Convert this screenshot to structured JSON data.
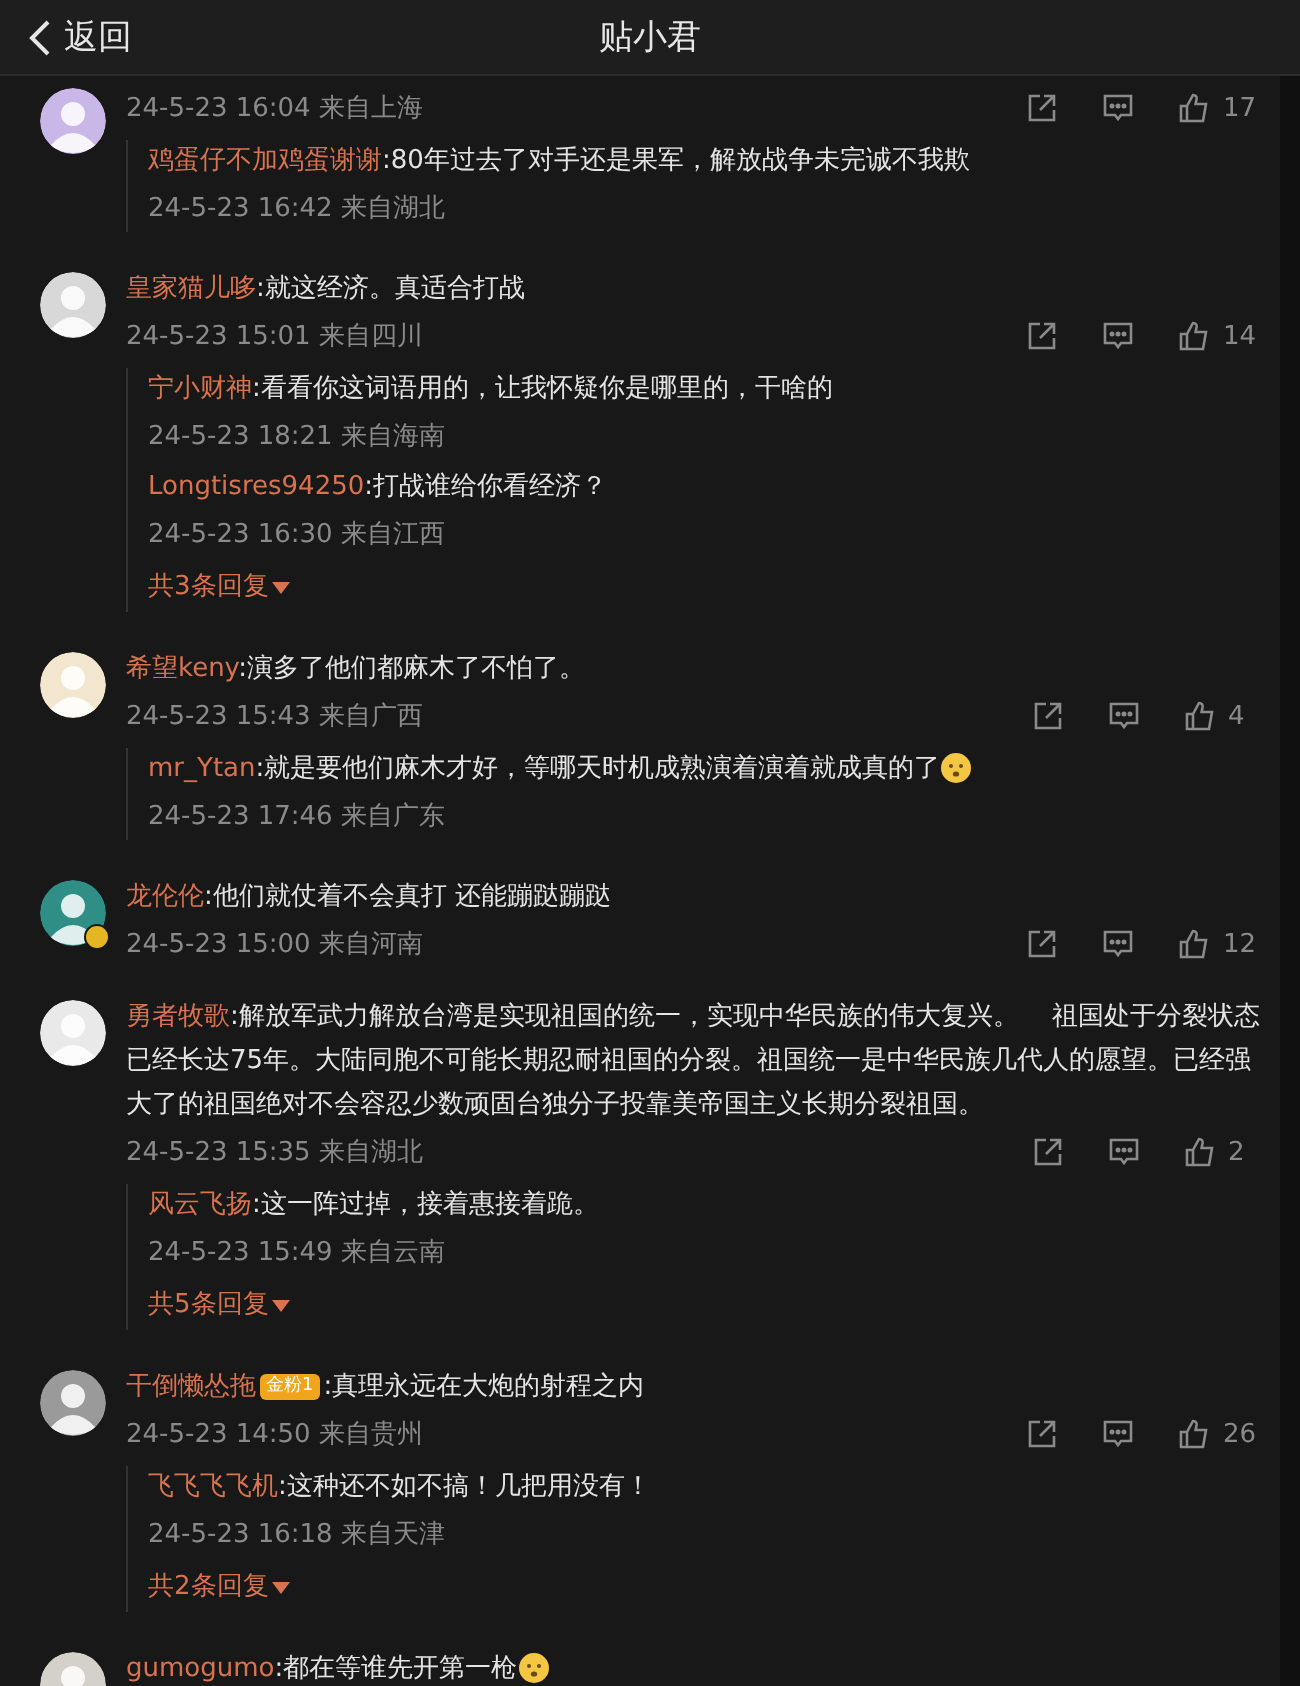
{
  "header": {
    "back_label": "返回",
    "title": "贴小君"
  },
  "comments": [
    {
      "time": "24-5-23 16:04",
      "location": "来自上海",
      "likes": "17",
      "verified": false,
      "replies": [
        {
          "author": "鸡蛋仔不加鸡蛋谢谢",
          "text": ":80年过去了对手还是果军，解放战争未完诚不我欺",
          "time": "24-5-23 16:42",
          "location": "来自湖北",
          "emoji": false
        }
      ]
    },
    {
      "author": "皇家猫儿哆",
      "text": ":就这经济。真适合打战",
      "time": "24-5-23 15:01",
      "location": "来自四川",
      "likes": "14",
      "verified": false,
      "emoji": false,
      "replies": [
        {
          "author": "宁小财神",
          "text": ":看看你这词语用的，让我怀疑你是哪里的，干啥的",
          "time": "24-5-23 18:21",
          "location": "来自海南",
          "emoji": false
        },
        {
          "author": "Longtisres94250",
          "text": ":打战谁给你看经济？",
          "time": "24-5-23 16:30",
          "location": "来自江西",
          "emoji": false
        }
      ],
      "more": "共3条回复"
    },
    {
      "author": "希望keny",
      "text": ":演多了他们都麻木了不怕了。",
      "time": "24-5-23 15:43",
      "location": "来自广西",
      "likes": "4",
      "verified": false,
      "emoji": false,
      "replies": [
        {
          "author": "mr_Ytan",
          "text": ":就是要他们麻木才好，等哪天时机成熟演着演着就成真的了",
          "time": "24-5-23 17:46",
          "location": "来自广东",
          "emoji": true
        }
      ]
    },
    {
      "author": "龙伦伦",
      "text": ":他们就仗着不会真打 还能蹦跶蹦跶",
      "time": "24-5-23 15:00",
      "location": "来自河南",
      "likes": "12",
      "verified": true,
      "emoji": false
    },
    {
      "author": "勇者牧歌",
      "text": ":解放军武力解放台湾是实现祖国的统一，实现中华民族的伟大复兴。    祖国处于分裂状态已经长达75年。大陆同胞不可能长期忍耐祖国的分裂。祖国统一是中华民族几代人的愿望。已经强大了的祖国绝对不会容忍少数顽固台独分子投靠美帝国主义长期分裂祖国。",
      "time": "24-5-23 15:35",
      "location": "来自湖北",
      "likes": "2",
      "verified": false,
      "emoji": false,
      "replies": [
        {
          "author": "风云飞扬",
          "text": ":这一阵过掉，接着惠接着跪。",
          "time": "24-5-23 15:49",
          "location": "来自云南",
          "emoji": false
        }
      ],
      "more": "共5条回复"
    },
    {
      "author": "干倒懒怂拖",
      "badge": "金粉1",
      "text": ":真理永远在大炮的射程之内",
      "time": "24-5-23 14:50",
      "location": "来自贵州",
      "likes": "26",
      "verified": false,
      "emoji": false,
      "replies": [
        {
          "author": "飞飞飞飞机",
          "text": ":这种还不如不搞！几把用没有！",
          "time": "24-5-23 16:18",
          "location": "来自天津",
          "emoji": false
        }
      ],
      "more": "共2条回复"
    },
    {
      "author": "gumogumo",
      "text": ":都在等谁先开第一枪",
      "emoji": true,
      "verified": false
    }
  ]
}
